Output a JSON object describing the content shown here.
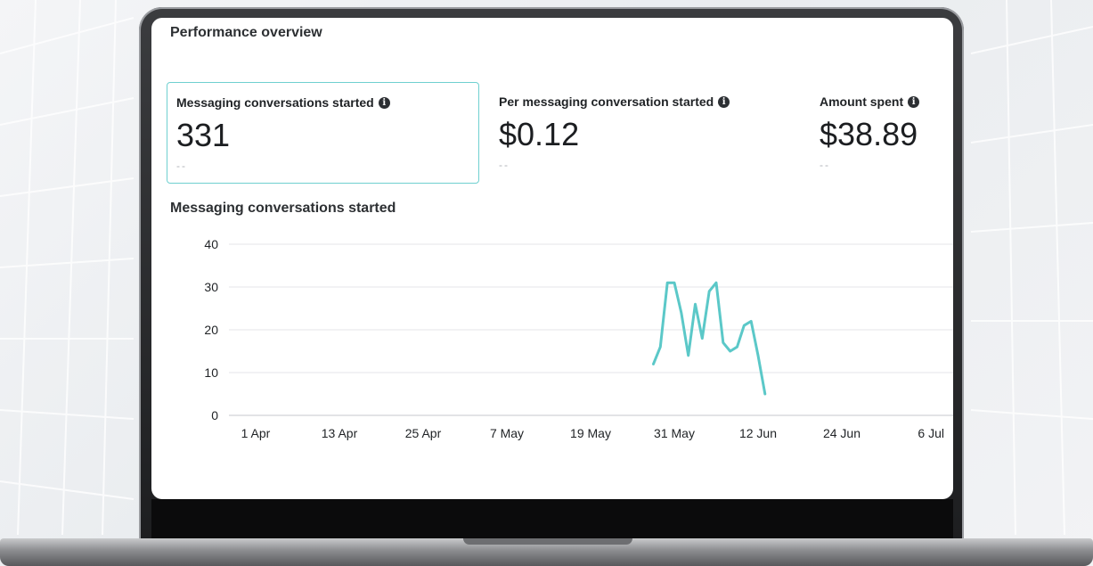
{
  "panel": {
    "title": "Performance overview"
  },
  "metrics": [
    {
      "label": "Messaging conversations started",
      "value": "331",
      "compare": "--",
      "selected": true
    },
    {
      "label": "Per messaging conversation started",
      "value": "$0.12",
      "compare": "--",
      "selected": false
    },
    {
      "label": "Amount spent",
      "value": "$38.89",
      "compare": "--",
      "selected": false
    }
  ],
  "icons": {
    "info": "info-icon"
  },
  "colors": {
    "accent": "#5bc8c8",
    "selected_border": "#6fd0d0"
  },
  "chart_data": {
    "type": "line",
    "title": "Messaging conversations started",
    "xlabel": "",
    "ylabel": "",
    "ylim": [
      0,
      40
    ],
    "yticks": [
      0,
      10,
      20,
      30,
      40
    ],
    "x_ticks": [
      "1 Apr",
      "13 Apr",
      "25 Apr",
      "7 May",
      "19 May",
      "31 May",
      "12 Jun",
      "24 Jun",
      "6 Jul"
    ],
    "grid": true,
    "series": [
      {
        "color": "#5bc8c8",
        "x": [
          "2023-05-28",
          "2023-05-29",
          "2023-05-30",
          "2023-05-31",
          "2023-06-01",
          "2023-06-02",
          "2023-06-03",
          "2023-06-04",
          "2023-06-05",
          "2023-06-06",
          "2023-06-07",
          "2023-06-08",
          "2023-06-09",
          "2023-06-10",
          "2023-06-11",
          "2023-06-12",
          "2023-06-13"
        ],
        "values": [
          12,
          16,
          31,
          31,
          24,
          14,
          26,
          18,
          29,
          31,
          17,
          15,
          16,
          21,
          22,
          14,
          5
        ]
      }
    ]
  }
}
